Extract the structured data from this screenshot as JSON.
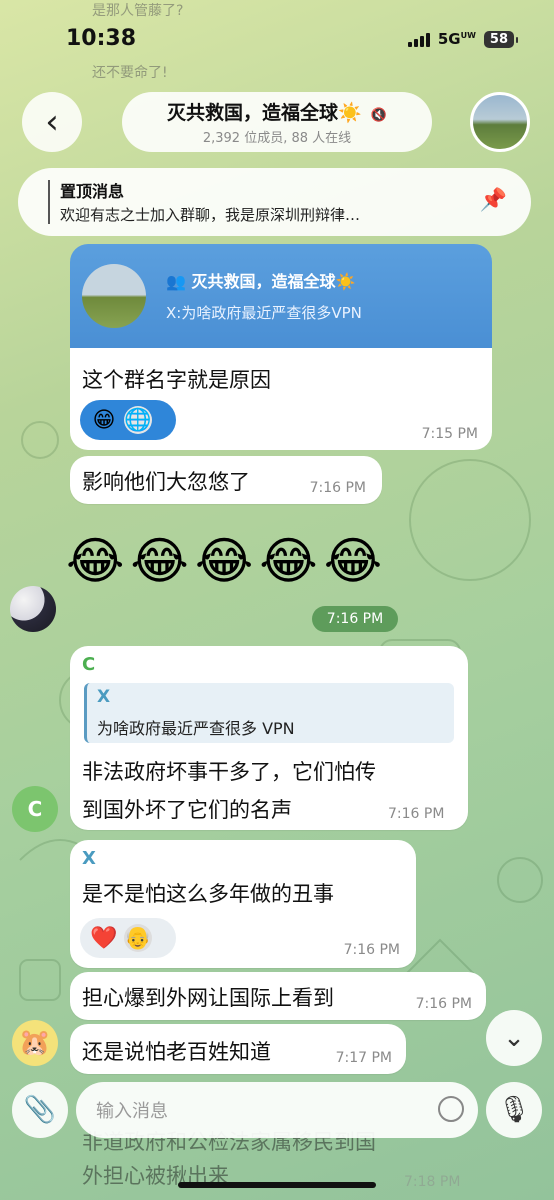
{
  "status": {
    "time": "10:38",
    "network": "5G",
    "network_sub": "UW",
    "battery": "58"
  },
  "header": {
    "title": "灭共救国，造福全球☀️",
    "subtitle": "2,392 位成员, 88 人在线",
    "back_icon": "chevron-left-icon",
    "mute_icon": "speaker-muted-icon"
  },
  "bg_faded": {
    "line1": "是那人管藤了?",
    "line2": "还不要命了!"
  },
  "pinned": {
    "title": "置顶消息",
    "text": "欢迎有志之士加入群聊，我是原深圳刑辩律…"
  },
  "messages": {
    "card": {
      "title": "灭共救国，造福全球☀️",
      "subtitle": "X:为啥政府最近严查很多VPN"
    },
    "m1": {
      "text": "这个群名字就是原因",
      "time": "7:15 PM",
      "reactions": [
        "😁",
        "🌐"
      ]
    },
    "m2": {
      "text": "影响他们大忽悠了",
      "time": "7:16 PM"
    },
    "laughs": "😂😂😂😂😂",
    "laughs_time": "7:16 PM",
    "m4": {
      "sender": "C",
      "reply_sender": "X",
      "reply_text": "为啥政府最近严查很多 VPN",
      "text_line1": "非法政府坏事干多了，它们怕传",
      "text_line2": "到国外坏了它们的名声",
      "time": "7:16 PM"
    },
    "m5": {
      "sender": "X",
      "text": "是不是怕这么多年做的丑事",
      "time": "7:16 PM",
      "reactions": [
        "❤️",
        "👴"
      ]
    },
    "m6": {
      "text": "担心爆到外网让国际上看到",
      "time": "7:16 PM"
    },
    "m7": {
      "text": "还是说怕老百姓知道",
      "time": "7:17 PM"
    },
    "m8_partial": {
      "text_line1": "非道政府和公检法家属移民到国",
      "text_line2": "外担心被揪出来",
      "time": "7:18 PM"
    }
  },
  "avatars": {
    "c_letter": "C"
  },
  "composer": {
    "placeholder": "输入消息"
  },
  "colors": {
    "accent_green": "#5e9c5b",
    "link_blue": "#4a8fd4",
    "sender_green": "#4caf50",
    "sender_teal": "#4a9bc0"
  }
}
